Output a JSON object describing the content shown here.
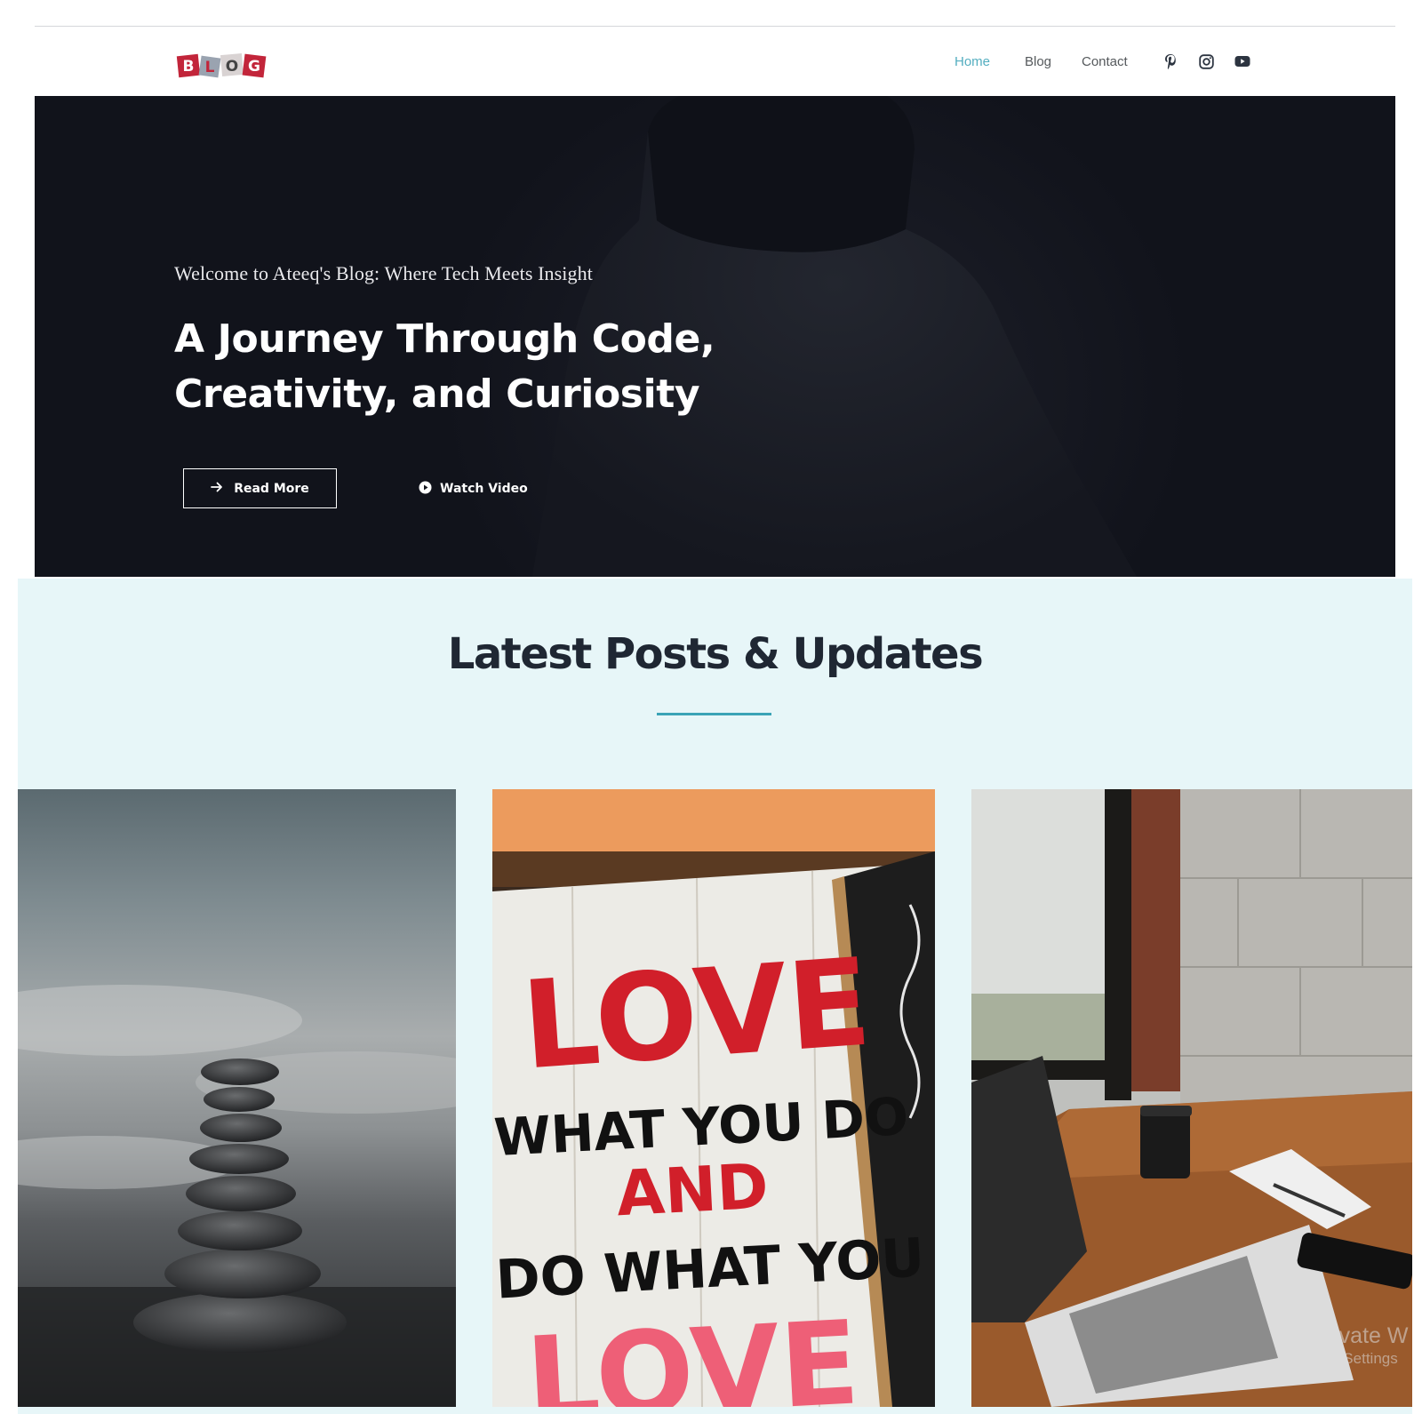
{
  "header": {
    "logo_letters": [
      "B",
      "L",
      "O",
      "G"
    ],
    "nav": [
      {
        "label": "Home",
        "active": true
      },
      {
        "label": "Blog",
        "active": false
      },
      {
        "label": "Contact",
        "active": false
      }
    ],
    "social_icons": [
      "pinterest-icon",
      "instagram-icon",
      "youtube-icon"
    ]
  },
  "hero": {
    "eyebrow": "Welcome to Ateeq's Blog: Where Tech Meets Insight",
    "title_line1": "A Journey Through Code,",
    "title_line2": "Creativity, and Curiosity",
    "read_more_label": "Read More",
    "watch_video_label": "Watch Video"
  },
  "posts": {
    "heading": "Latest Posts & Updates",
    "cards": [
      {
        "image": "stacked-stones-photo"
      },
      {
        "image": "love-sign-photo",
        "sign_lines": [
          "LOVE",
          "WHAT YOU DO",
          "AND",
          "DO WHAT YOU",
          "LOVE"
        ]
      },
      {
        "image": "laptop-desk-photo"
      }
    ]
  },
  "os_watermark": {
    "line1": "Activate W",
    "line2": "Go to Settings"
  },
  "colors": {
    "accent": "#54aec0",
    "underline": "#3aa3b6",
    "hero_bg": "#14161e",
    "posts_bg": "#e7f6f8",
    "logo_red": "#c2253a"
  }
}
